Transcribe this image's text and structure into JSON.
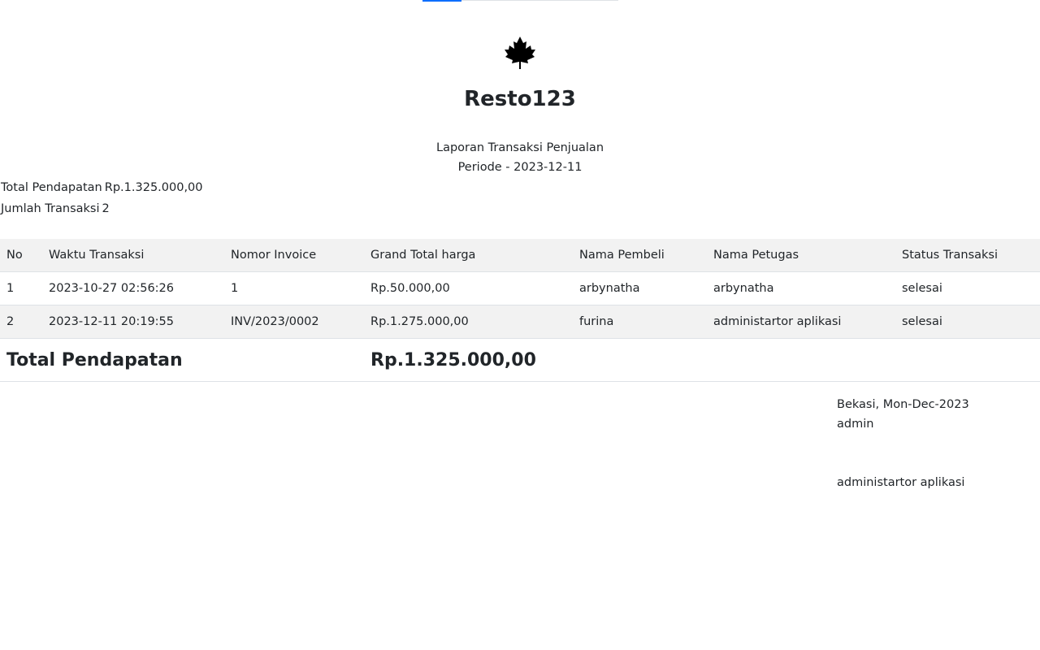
{
  "progress": {
    "fraction": 0.2,
    "color": "#0d6efd"
  },
  "logo": {
    "icon": "maple-leaf-icon"
  },
  "app_title": "Resto123",
  "report": {
    "title": "Laporan Transaksi Penjualan",
    "period": "Periode - 2023-12-11"
  },
  "summary": {
    "total_label": "Total Pendapatan",
    "total_value": "Rp.1.325.000,00",
    "count_label": "Jumlah Transaksi",
    "count_value": "2"
  },
  "table": {
    "headers": [
      "No",
      "Waktu Transaksi",
      "Nomor Invoice",
      "Grand Total harga",
      "Nama Pembeli",
      "Nama Petugas",
      "Status Transaksi"
    ],
    "rows": [
      [
        "1",
        "2023-10-27 02:56:26",
        "1",
        "Rp.50.000,00",
        "arbynatha",
        "arbynatha",
        "selesai"
      ],
      [
        "2",
        "2023-12-11 20:19:55",
        "INV/2023/0002",
        "Rp.1.275.000,00",
        "furina",
        "administartor aplikasi",
        "selesai"
      ]
    ],
    "footer_label": "Total Pendapatan",
    "footer_value": "Rp.1.325.000,00"
  },
  "signature": {
    "place_date": "Bekasi, Mon-Dec-2023",
    "role": "admin",
    "name": "administartor aplikasi"
  }
}
